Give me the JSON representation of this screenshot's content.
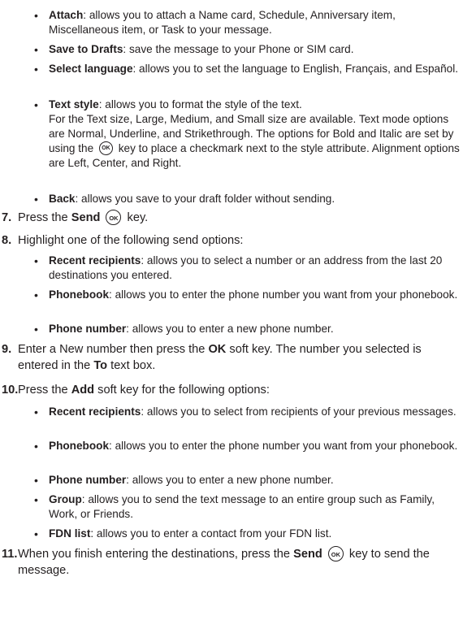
{
  "ok_key_icon": "OK",
  "intro_bullets": [
    {
      "term": "Attach",
      "text": ": allows you to attach a Name card, Schedule, Anniversary item, Miscellaneous item, or Task to your message."
    },
    {
      "term": "Save to Drafts",
      "text": ": save the message to your Phone or SIM card."
    },
    {
      "term": "Select language",
      "text": ": allows you to set the language to English, Français, and Español."
    },
    {
      "term": "Text style",
      "text": ": allows you to format the style of the text.",
      "line2": "For the Text size, Large, Medium, and Small size are available. Text mode options are Normal, Underline, and Strikethrough. The options for Bold and Italic are set by using the",
      "line3": "key to place a checkmark next to the style attribute. Alignment options are Left, Center, and Right."
    },
    {
      "term": "Back",
      "text": ": allows you save to your draft folder without sending."
    }
  ],
  "step7": {
    "num": "7.",
    "pre": "Press the",
    "bold": "Send",
    "post": "key."
  },
  "step8": {
    "num": "8.",
    "text": "Highlight one of the following send options:"
  },
  "step8_bullets": [
    {
      "term": "Recent recipients",
      "text": ": allows you to select a number or an address from the last 20 destinations you entered."
    },
    {
      "term": "Phonebook",
      "text": ": allows you to enter the phone number you want from your phonebook."
    },
    {
      "term": "Phone number",
      "text": ": allows you to enter a new phone number."
    }
  ],
  "step9": {
    "num": "9.",
    "pre": "Enter a New number then press the",
    "bold1": "OK",
    "mid": "soft key. The number you selected is entered in the",
    "bold2": "To",
    "post": "text box."
  },
  "step10": {
    "num": "10.",
    "pre": "Press the",
    "bold": "Add",
    "post": "soft key for the following options:"
  },
  "step10_bullets": [
    {
      "term": "Recent recipients",
      "text": ": allows you to select from recipients of your previous messages."
    },
    {
      "term": "Phonebook",
      "text": ": allows you to enter the phone number you want from your phonebook."
    },
    {
      "term": "Phone number",
      "text": ": allows you to enter a new phone number."
    },
    {
      "term": "Group",
      "text": ": allows you to send the text message to an entire group such as Family, Work, or Friends."
    },
    {
      "term": "FDN list",
      "text": ": allows you to enter a contact from your FDN list."
    }
  ],
  "step11": {
    "num": "11.",
    "pre": "When you finish entering the destinations, press the",
    "bold": "Send",
    "post": "key to send the message."
  }
}
